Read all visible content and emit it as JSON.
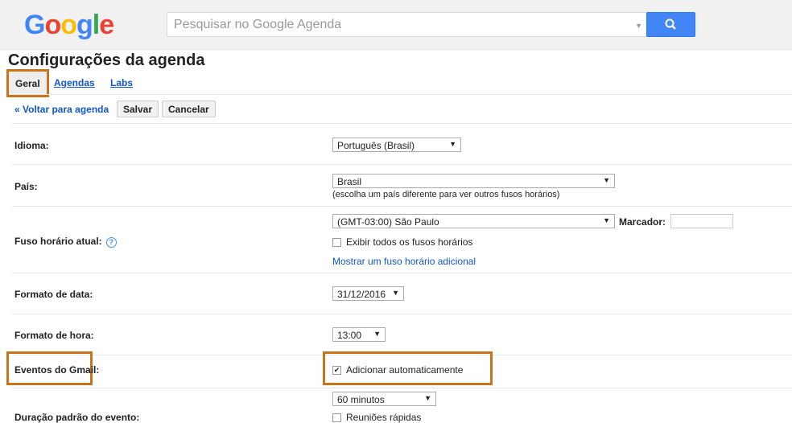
{
  "header": {
    "logo": "Google",
    "search_placeholder": "Pesquisar no Google Agenda"
  },
  "page_title": "Configurações da agenda",
  "tabs": [
    "Geral",
    "Agendas",
    "Labs"
  ],
  "toolbar": {
    "back": "« Voltar para agenda",
    "save": "Salvar",
    "cancel": "Cancelar"
  },
  "settings": {
    "language": {
      "label": "Idioma:",
      "value": "Português (Brasil)"
    },
    "country": {
      "label": "País:",
      "value": "Brasil",
      "note": "(escolha um país diferente para ver outros fusos horários)"
    },
    "timezone": {
      "label": "Fuso horário atual:",
      "value": "(GMT-03:00) São Paulo",
      "marker_label": "Marcador:",
      "marker_value": "",
      "show_all": "Exibir todos os fusos horários",
      "add_link": "Mostrar um fuso horário adicional"
    },
    "date_format": {
      "label": "Formato de data:",
      "value": "31/12/2016"
    },
    "time_format": {
      "label": "Formato de hora:",
      "value": "13:00"
    },
    "gmail_events": {
      "label": "Eventos do Gmail:",
      "option": "Adicionar automaticamente",
      "checked": true
    },
    "duration": {
      "label": "Duração padrão do evento:",
      "value": "60 minutos",
      "option": "Reuniões rápidas"
    }
  }
}
